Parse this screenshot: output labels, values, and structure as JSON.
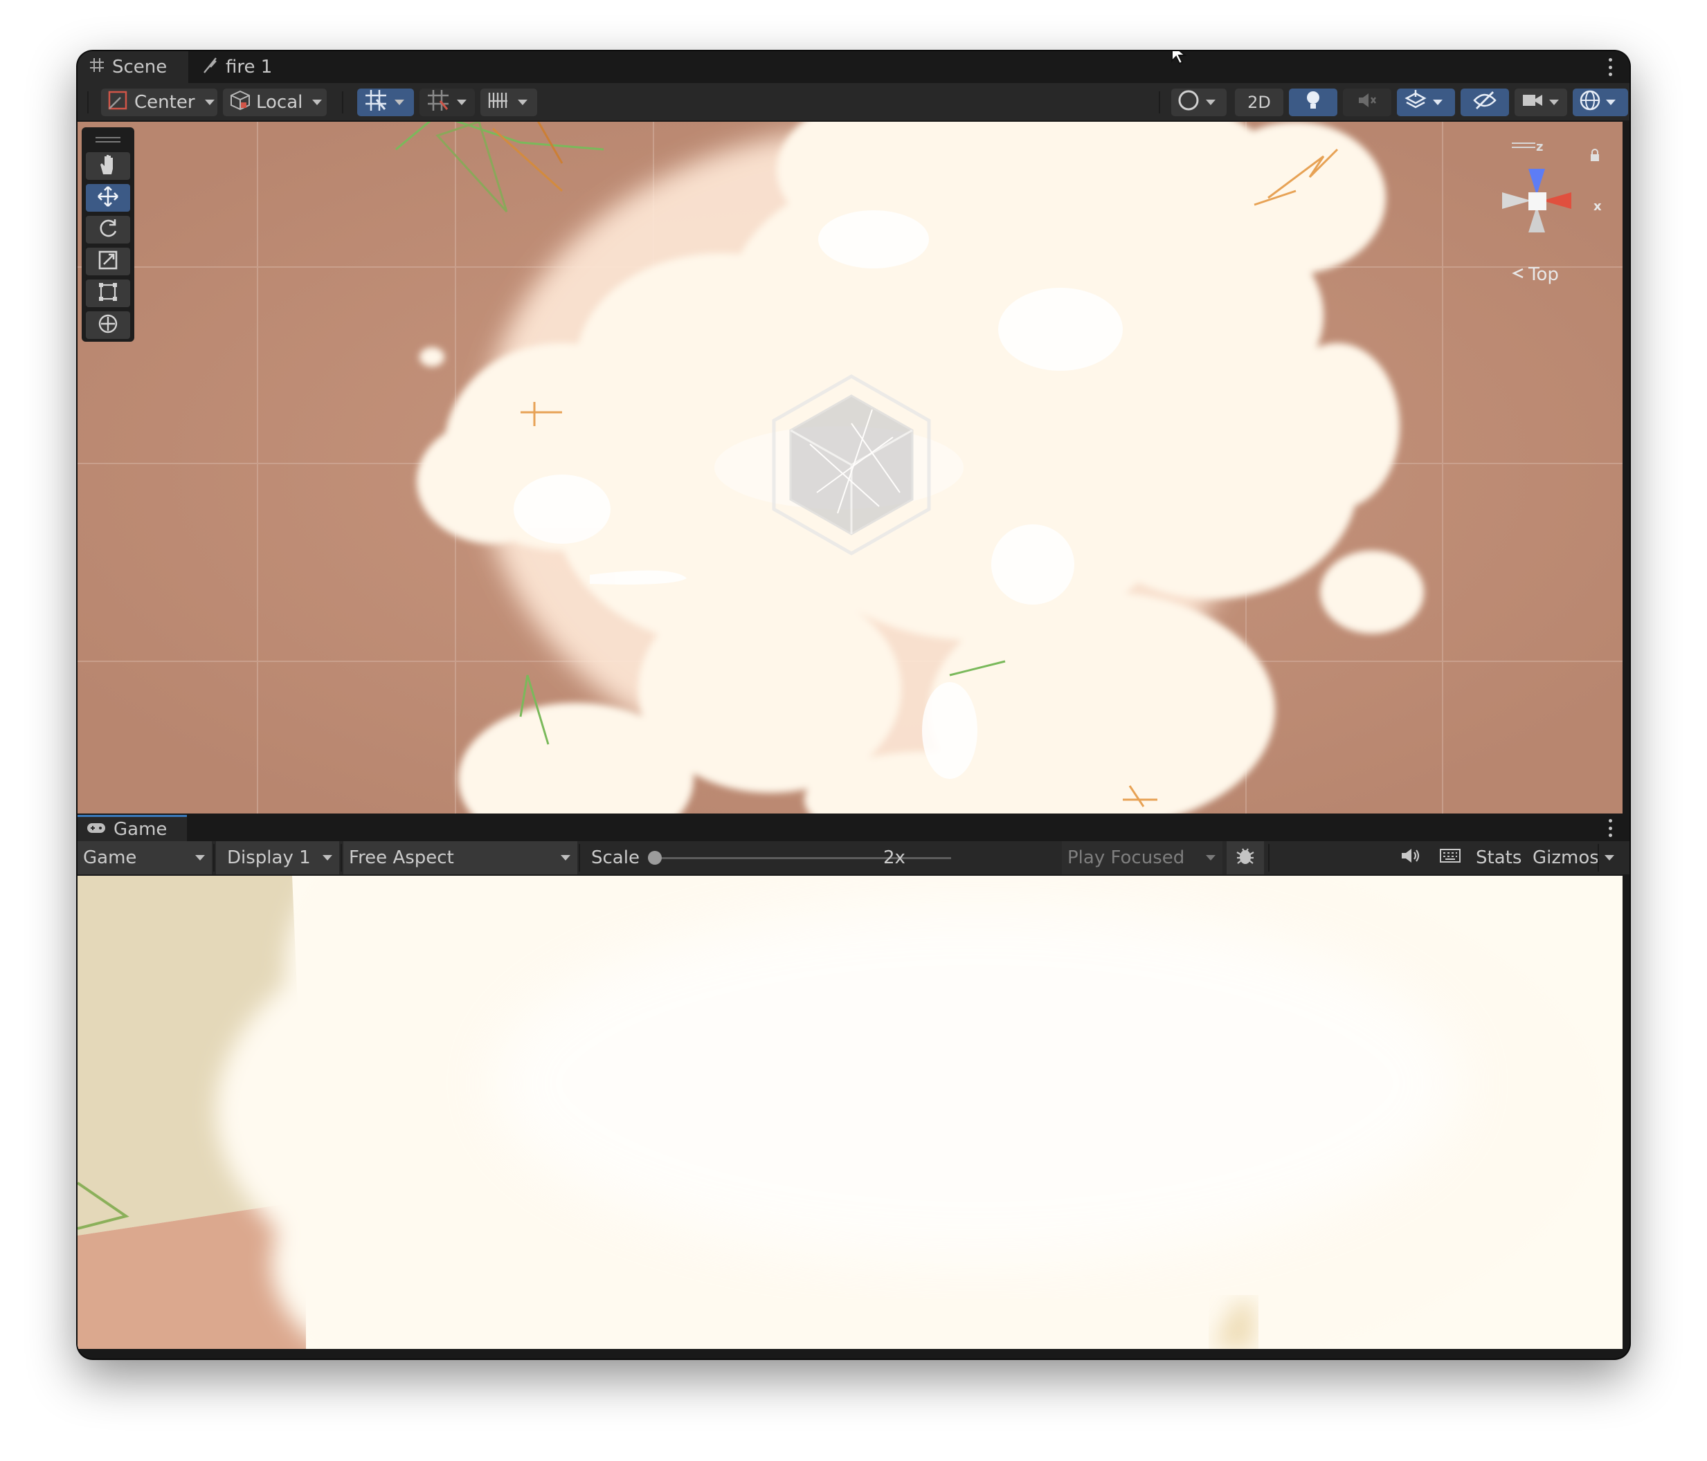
{
  "scene_panel": {
    "tabs": [
      {
        "label": "Scene",
        "icon": "grid-hash-icon",
        "active": true
      },
      {
        "label": "fire 1",
        "icon": "feather-icon",
        "active": false
      }
    ],
    "toolbar": {
      "pivot_label": "Center",
      "space_label": "Local",
      "mode_2d_label": "2D"
    },
    "tools": [
      "hand-tool-icon",
      "move-tool-icon",
      "rotate-tool-icon",
      "scale-tool-icon",
      "rect-tool-icon",
      "transform-tool-icon"
    ],
    "selected_tool": "move-tool-icon",
    "orientation": {
      "view_label": "Top",
      "axis_z": "z",
      "axis_x": "x",
      "colors": {
        "z": "#5d7df5",
        "x": "#e0503e",
        "neutral": "#cfcfcf"
      }
    }
  },
  "game_panel": {
    "tab": {
      "label": "Game",
      "icon": "gamepad-icon"
    },
    "toolbar": {
      "mode_dropdown": "Game",
      "display_dropdown": "Display 1",
      "aspect_dropdown": "Free Aspect",
      "scale_label": "Scale",
      "scale_value": "2x",
      "play_focus_dropdown": "Play Focused",
      "stats_label": "Stats",
      "gizmos_label": "Gizmos"
    }
  },
  "colors": {
    "editor_bg": "#191919",
    "toolbar_bg": "#282828",
    "active_blue": "#3c5a86",
    "scene_background": "#c1917c",
    "smoke": "#fff7ea"
  }
}
